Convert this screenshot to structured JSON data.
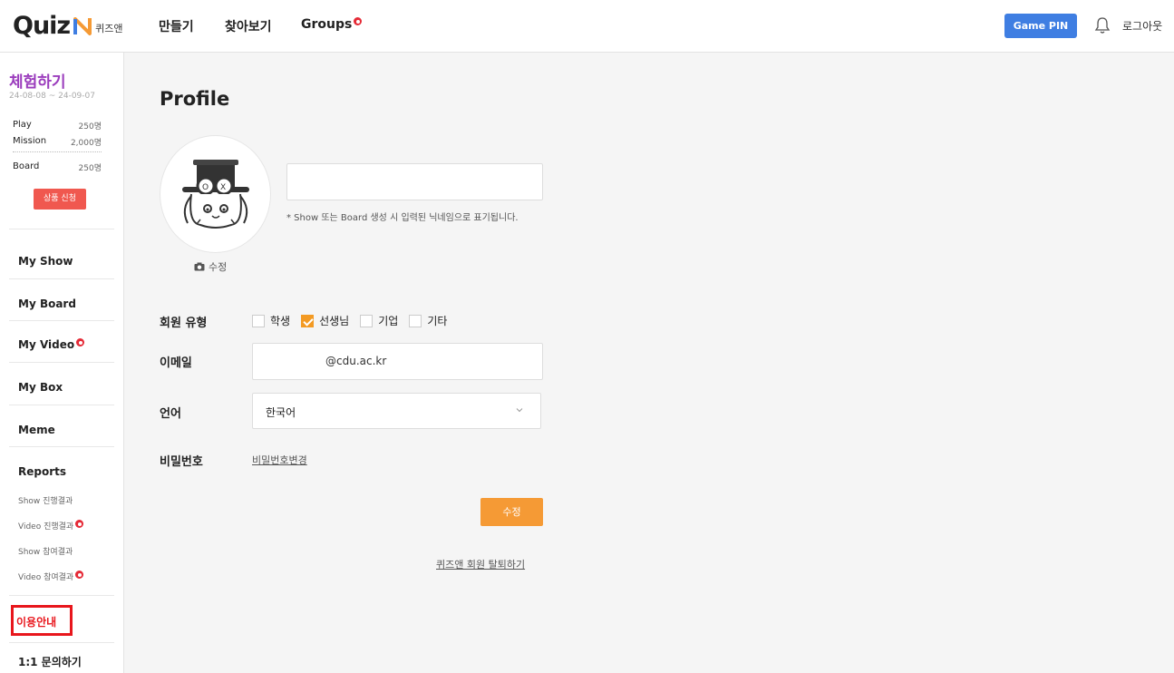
{
  "header": {
    "logo_text": "Quiz",
    "logo_sub": "퀴즈앤",
    "nav": [
      {
        "label": "만들기"
      },
      {
        "label": "찾아보기"
      },
      {
        "label": "Groups"
      }
    ],
    "game_pin_label": "Game PIN",
    "logout_label": "로그아웃",
    "colors": {
      "brand_orange": "#f59a35",
      "brand_blue": "#3f7ee2",
      "badge_red": "#e52a36"
    }
  },
  "sidebar": {
    "trial_title": "체험하기",
    "trial_period": "24-08-08 ~ 24-09-07",
    "quota": [
      {
        "label": "Play",
        "value": "250명"
      },
      {
        "label": "Mission",
        "value": "2,000명"
      },
      {
        "label": "Board",
        "value": "250명"
      }
    ],
    "apply_label": "상품 신청",
    "items": [
      {
        "label": "My Show"
      },
      {
        "label": "My Board"
      },
      {
        "label": "My Video"
      },
      {
        "label": "My Box"
      },
      {
        "label": "Meme"
      },
      {
        "label": "Reports"
      }
    ],
    "reports_sub": [
      {
        "label": "Show 진행결과"
      },
      {
        "label": "Video 진행결과"
      },
      {
        "label": "Show 참여결과"
      },
      {
        "label": "Video 참여결과"
      }
    ],
    "guide_label": "이용안내",
    "inquiry_label": "1:1 문의하기"
  },
  "main": {
    "title": "Profile",
    "edit_photo_label": "수정",
    "nickname_value": "",
    "nickname_hint": "* Show 또는 Board 생성 시 입력된 닉네임으로 표기됩니다.",
    "member_type_label": "회원 유형",
    "member_types": [
      {
        "label": "학생",
        "checked": false
      },
      {
        "label": "선생님",
        "checked": true
      },
      {
        "label": "기업",
        "checked": false
      },
      {
        "label": "기타",
        "checked": false
      }
    ],
    "email_label": "이메일",
    "email_value": "@cdu.ac.kr",
    "language_label": "언어",
    "language_value": "한국어",
    "password_label": "비밀번호",
    "password_change_label": "비밀번호변경",
    "submit_label": "수정",
    "withdraw_label": "퀴즈앤 회원 탈퇴하기"
  }
}
